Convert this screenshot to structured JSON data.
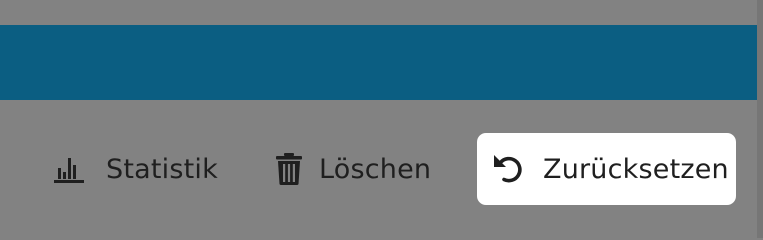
{
  "colors": {
    "background": "#828282",
    "header": "#0b5e82",
    "text": "#1f1f1f",
    "active_button_bg": "#ffffff"
  },
  "toolbar": {
    "statistics": {
      "label": "Statistik",
      "icon": "bar-chart-icon"
    },
    "delete": {
      "label": "Löschen",
      "icon": "trash-icon"
    },
    "reset": {
      "label": "Zurücksetzen",
      "icon": "undo-icon"
    }
  }
}
